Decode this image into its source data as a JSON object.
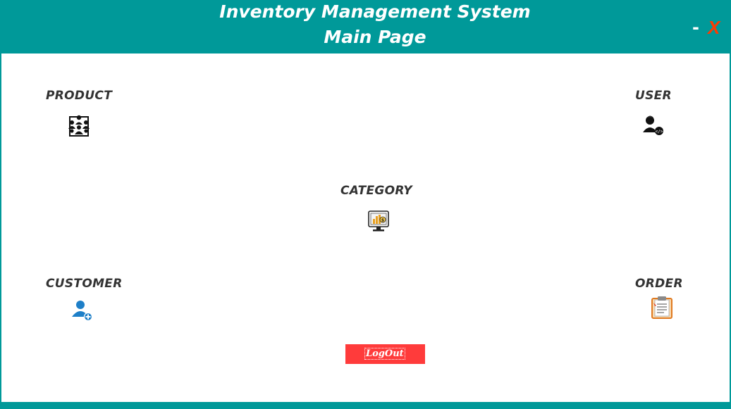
{
  "header": {
    "title_line1": "Inventory Management System",
    "title_line2": "Main Page",
    "minimize_label": "-",
    "close_label": "X"
  },
  "modules": {
    "product": {
      "label": "PRODUCT",
      "icon": "people-group-icon"
    },
    "user": {
      "label": "USER",
      "icon": "user-code-icon"
    },
    "category": {
      "label": "CATEGORY",
      "icon": "monitor-chart-icon"
    },
    "customer": {
      "label": "CUSTOMER",
      "icon": "add-user-icon"
    },
    "order": {
      "label": "ORDER",
      "icon": "clipboard-icon"
    }
  },
  "logout": {
    "label": "LogOut"
  },
  "colors": {
    "primary": "#009999",
    "close": "#ff3b00",
    "logout": "#ff3b3b",
    "label": "#333333"
  }
}
